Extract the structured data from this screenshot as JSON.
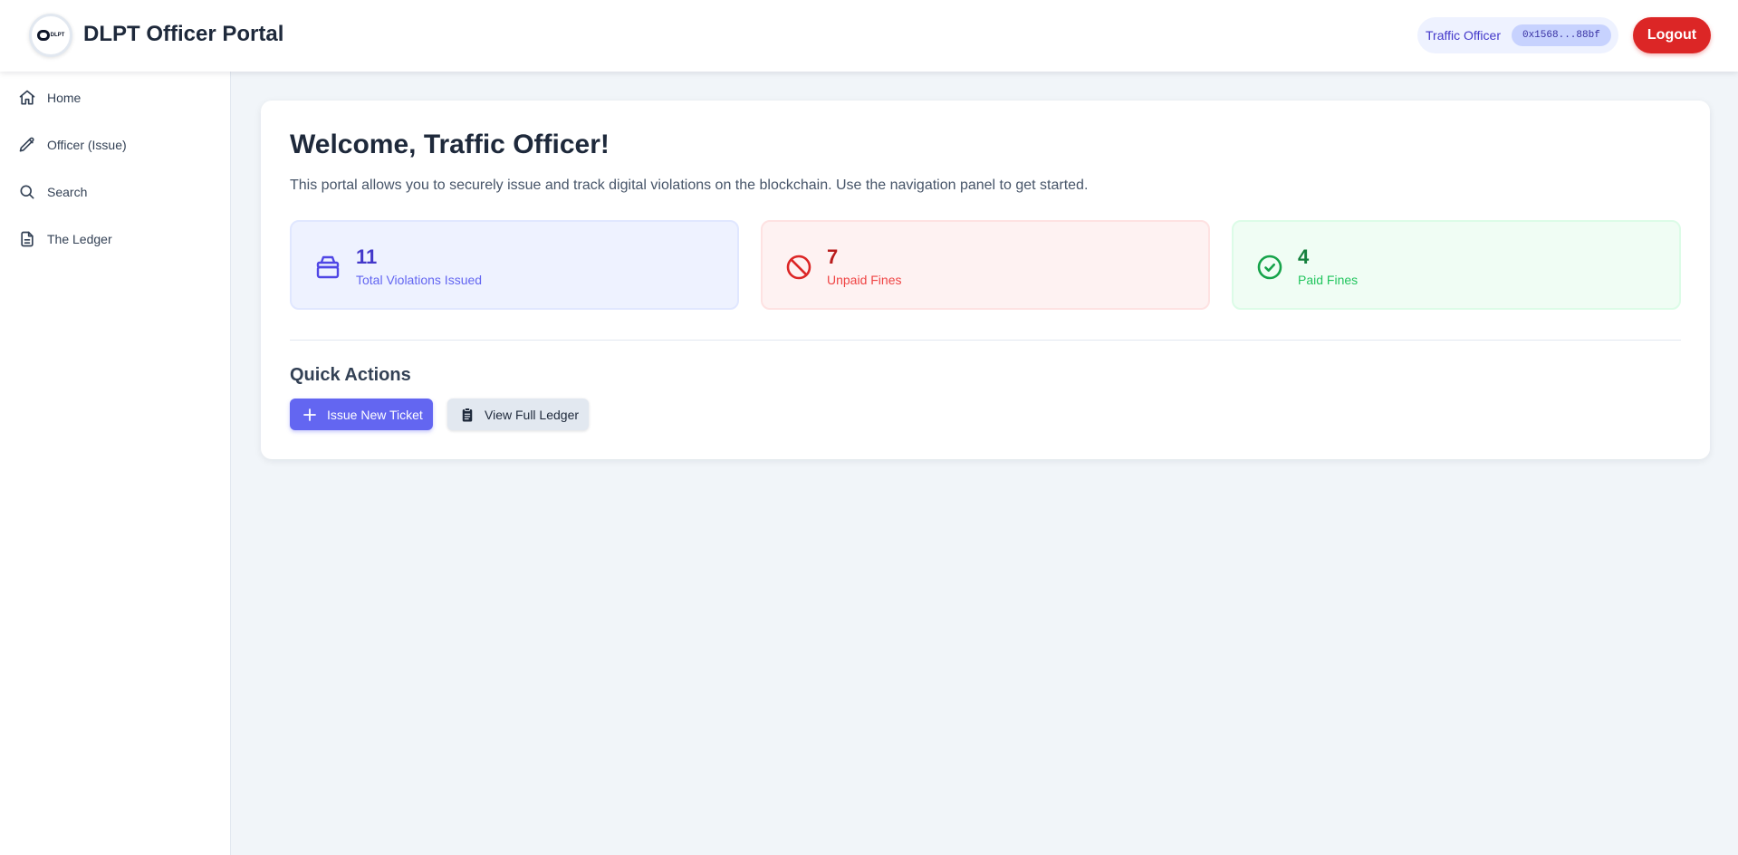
{
  "header": {
    "logo_text": "DLPT",
    "title": "DLPT Officer Portal",
    "user_role": "Traffic Officer",
    "wallet_address": "0x1568...88bf",
    "logout_label": "Logout"
  },
  "sidebar": {
    "items": [
      {
        "label": "Home",
        "icon": "home-icon"
      },
      {
        "label": "Officer (Issue)",
        "icon": "pencil-icon"
      },
      {
        "label": "Search",
        "icon": "search-icon"
      },
      {
        "label": "The Ledger",
        "icon": "document-icon"
      }
    ]
  },
  "main": {
    "welcome_title": "Welcome, Traffic Officer!",
    "intro_text": "This portal allows you to securely issue and track digital violations on the blockchain. Use the navigation panel to get started.",
    "stats": [
      {
        "value": "11",
        "label": "Total Violations Issued",
        "icon": "stack-icon",
        "color": "#4338ca"
      },
      {
        "value": "7",
        "label": "Unpaid Fines",
        "icon": "ban-icon",
        "color": "#b91c1c"
      },
      {
        "value": "4",
        "label": "Paid Fines",
        "icon": "check-circle-icon",
        "color": "#15803d"
      }
    ],
    "quick_actions_title": "Quick Actions",
    "actions": [
      {
        "label": "Issue New Ticket",
        "icon": "plus-icon"
      },
      {
        "label": "View Full Ledger",
        "icon": "clipboard-icon"
      }
    ]
  },
  "colors": {
    "accent": "#6366f1",
    "danger": "#dc2626",
    "success": "#16a34a",
    "background": "#f1f5f9"
  }
}
